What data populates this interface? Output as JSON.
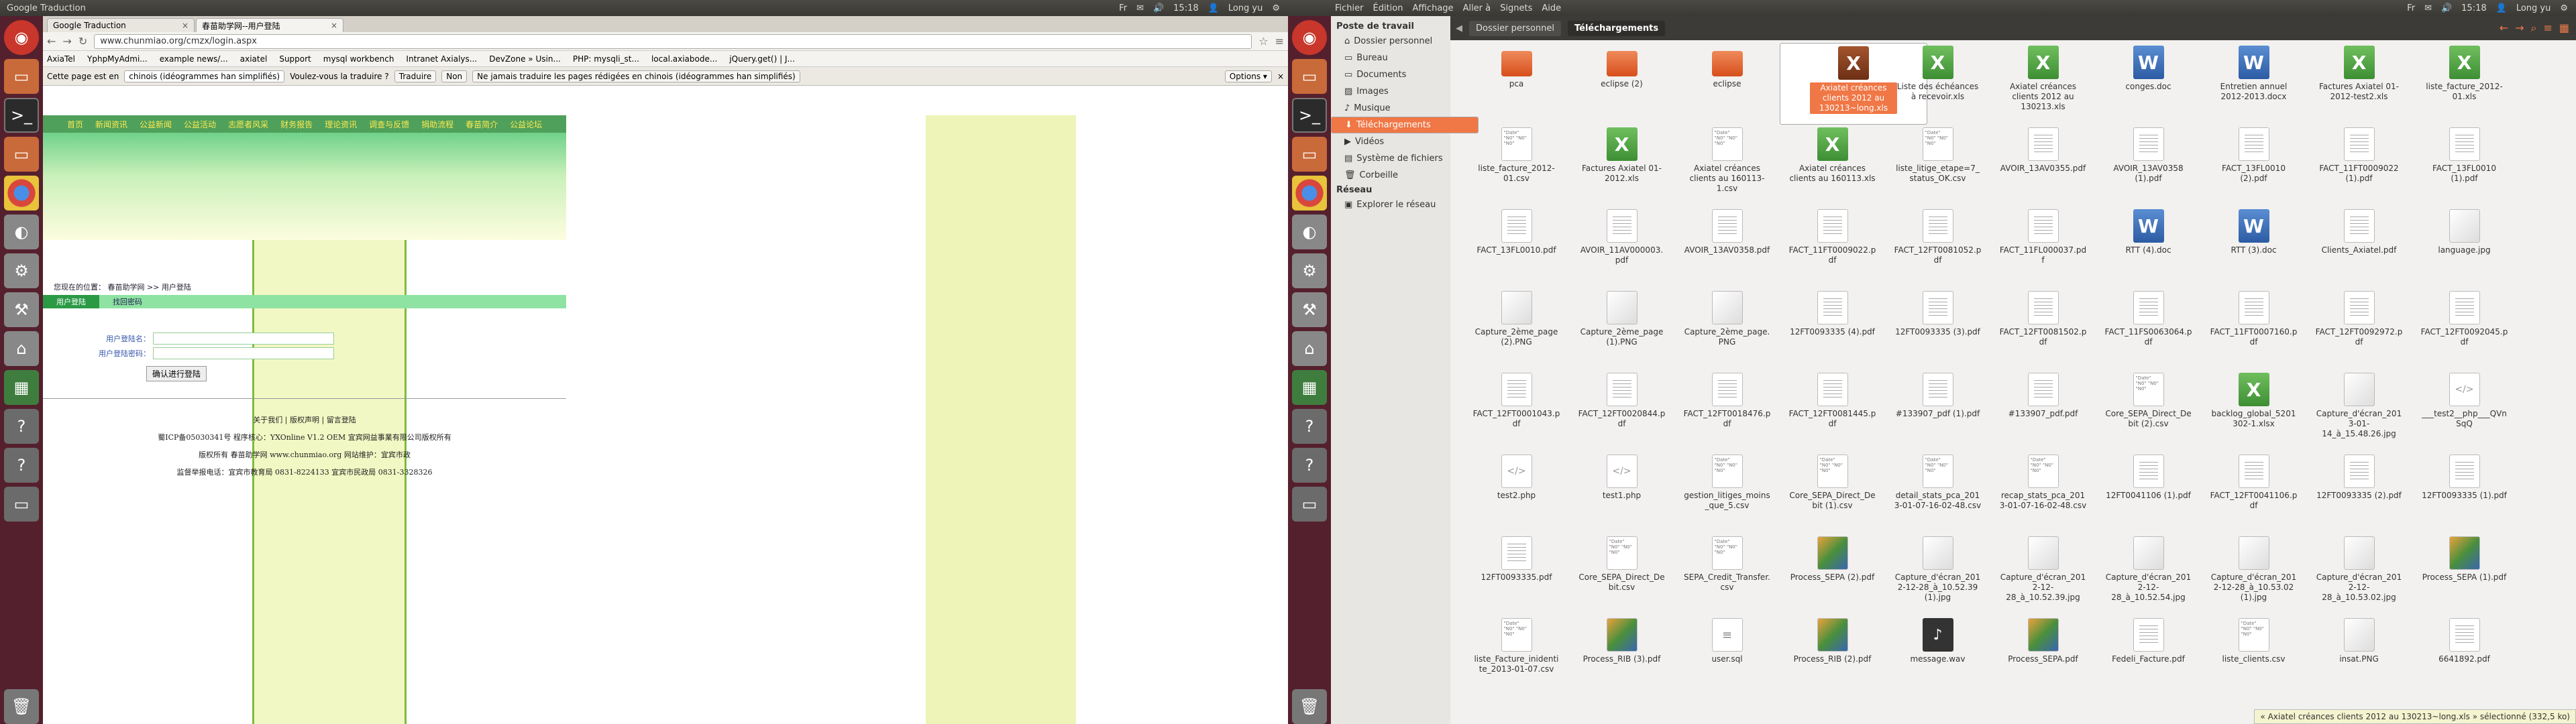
{
  "screen1": {
    "topbar": {
      "title": "Google Traduction",
      "right_items": [
        "Fr",
        "✉",
        "🔊",
        "15:18",
        "👤",
        "Long yu",
        "⚙"
      ]
    },
    "browser": {
      "tabs": [
        {
          "label": "Google Traduction"
        },
        {
          "label": "春苗助学网--用户登陆"
        }
      ],
      "url": "www.chunmiao.org/cmzx/login.aspx",
      "bookmarks": [
        "AxiaTel",
        "YphpMyAdmi...",
        "example news/...",
        "axiatel",
        "Support",
        "mysql workbench",
        "Intranet Axialys...",
        "DevZone » Usin...",
        "PHP: mysqli_st...",
        "local.axiabode...",
        "jQuery.get() | J..."
      ],
      "translate_bar": {
        "prompt": "Cette page est en",
        "language": "chinois (idéogrammes han simplifiés)",
        "question": "Voulez-vous la traduire ?",
        "translate": "Traduire",
        "no": "Non",
        "never": "Ne jamais traduire les pages rédigées en chinois (idéogrammes han simplifiés)",
        "options": "Options ▾"
      },
      "page": {
        "nav": [
          "首页",
          "新闻资讯",
          "公益新闻",
          "公益活动",
          "志愿者风采",
          "财务报告",
          "理论资讯",
          "调查与反馈",
          "捐助流程",
          "春苗简介",
          "公益论坛"
        ],
        "breadcrumb": "您现在的位置： 春苗助学网 >> 用户登陆",
        "tabs": [
          "用户登陆",
          "找回密码"
        ],
        "user_label": "用户登陆名：",
        "pass_label": "用户登陆密码：",
        "login_button": "确认进行登陆",
        "footer": [
          "关于我们 | 版权声明 | 留言登陆",
          "蜀ICP备05030341号 程序核心：YXOnline V1.2 OEM 宜宾网益事業有限公司版权所有",
          "版权所有 春苗助学网 www.chunmiao.org 网站维护：宜宾市政",
          "监督举报电话：宜宾市教育局 0831-8224133 宜宾市民政局 0831-3328326"
        ]
      }
    }
  },
  "screen2": {
    "topbar": {
      "menu": [
        "Fichier",
        "Édition",
        "Affichage",
        "Aller à",
        "Signets",
        "Aide"
      ],
      "right_items": [
        "Fr",
        "✉",
        "🔊",
        "15:18",
        "👤",
        "Long yu",
        "⚙"
      ]
    },
    "sidebar": {
      "header1": "Poste de travail",
      "items": [
        "Dossier personnel",
        "Bureau",
        "Documents",
        "Images",
        "Musique",
        "Téléchargements",
        "Vidéos",
        "Système de fichiers",
        "Corbeille"
      ],
      "header2": "Réseau",
      "items2": [
        "Explorer le réseau"
      ]
    },
    "breadcrumb": [
      "Dossier personnel",
      "Téléchargements"
    ],
    "files": [
      {
        "name": "pca",
        "type": "folder"
      },
      {
        "name": "eclipse (2)",
        "type": "folder"
      },
      {
        "name": "eclipse",
        "type": "folder"
      },
      {
        "name": "Axiatel créances clients 2012 au 130213~long.xls",
        "type": "xlsdark",
        "selected": true
      },
      {
        "name": "Liste des échéances à recevoir.xls",
        "type": "xls"
      },
      {
        "name": "Axiatel créances clients 2012 au 130213.xls",
        "type": "xls"
      },
      {
        "name": "conges.doc",
        "type": "doc"
      },
      {
        "name": "Entretien annuel 2012-2013.docx",
        "type": "doc"
      },
      {
        "name": "Factures Axiatel 01-2012-test2.xls",
        "type": "xls"
      },
      {
        "name": "liste_facture_2012-01.xls",
        "type": "xls"
      },
      {
        "name": "liste_facture_2012-01.csv",
        "type": "txt"
      },
      {
        "name": "Factures Axiatel 01-2012.xls",
        "type": "xls"
      },
      {
        "name": "Axiatel créances clients au 160113-1.csv",
        "type": "txt"
      },
      {
        "name": "Axiatel créances clients au 160113.xls",
        "type": "xls"
      },
      {
        "name": "liste_litige_etape=7_status_OK.csv",
        "type": "txt"
      },
      {
        "name": "AVOIR_13AV0355.pdf",
        "type": "pdf"
      },
      {
        "name": "AVOIR_13AV0358 (1).pdf",
        "type": "pdf"
      },
      {
        "name": "FACT_13FL0010 (2).pdf",
        "type": "pdf"
      },
      {
        "name": "FACT_11FT0009022 (1).pdf",
        "type": "pdf"
      },
      {
        "name": "FACT_13FL0010 (1).pdf",
        "type": "pdf"
      },
      {
        "name": "FACT_13FL0010.pdf",
        "type": "pdf"
      },
      {
        "name": "AVOIR_11AV000003.pdf",
        "type": "pdf"
      },
      {
        "name": "AVOIR_13AV0358.pdf",
        "type": "pdf"
      },
      {
        "name": "FACT_11FT0009022.pdf",
        "type": "pdf"
      },
      {
        "name": "FACT_12FT0081052.pdf",
        "type": "pdf"
      },
      {
        "name": "FACT_11FL000037.pdf",
        "type": "pdf"
      },
      {
        "name": "RTT (4).doc",
        "type": "doc"
      },
      {
        "name": "RTT (3).doc",
        "type": "doc"
      },
      {
        "name": "Clients_Axiatel.pdf",
        "type": "pdf"
      },
      {
        "name": "language.jpg",
        "type": "img"
      },
      {
        "name": "Capture_2ème_page (2).PNG",
        "type": "img"
      },
      {
        "name": "Capture_2ème_page (1).PNG",
        "type": "img"
      },
      {
        "name": "Capture_2ème_page.PNG",
        "type": "img"
      },
      {
        "name": "12FT0093335 (4).pdf",
        "type": "pdf"
      },
      {
        "name": "12FT0093335 (3).pdf",
        "type": "pdf"
      },
      {
        "name": "FACT_12FT0081502.pdf",
        "type": "pdf"
      },
      {
        "name": "FACT_11FS0063064.pdf",
        "type": "pdf"
      },
      {
        "name": "FACT_11FT0007160.pdf",
        "type": "pdf"
      },
      {
        "name": "FACT_12FT0092972.pdf",
        "type": "pdf"
      },
      {
        "name": "FACT_12FT0092045.pdf",
        "type": "pdf"
      },
      {
        "name": "FACT_12FT0001043.pdf",
        "type": "pdf"
      },
      {
        "name": "FACT_12FT0020844.pdf",
        "type": "pdf"
      },
      {
        "name": "FACT_12FT0018476.pdf",
        "type": "pdf"
      },
      {
        "name": "FACT_12FT0081445.pdf",
        "type": "pdf"
      },
      {
        "name": "#133907_pdf (1).pdf",
        "type": "pdf"
      },
      {
        "name": "#133907_pdf.pdf",
        "type": "pdf"
      },
      {
        "name": "Core_SEPA_Direct_Debit (2).csv",
        "type": "txt"
      },
      {
        "name": "backlog_global_5201302-1.xlsx",
        "type": "xls"
      },
      {
        "name": "Capture_d'écran_2013-01-14_à_15.48.26.jpg",
        "type": "img"
      },
      {
        "name": "___test2__php___QVnSqQ",
        "type": "code"
      },
      {
        "name": "test2.php",
        "type": "code"
      },
      {
        "name": "test1.php",
        "type": "code"
      },
      {
        "name": "gestion_litiges_moins_que_5.csv",
        "type": "txt"
      },
      {
        "name": "Core_SEPA_Direct_Debit (1).csv",
        "type": "txt"
      },
      {
        "name": "detail_stats_pca_2013-01-07-16-02-48.csv",
        "type": "txt"
      },
      {
        "name": "recap_stats_pca_2013-01-07-16-02-48.csv",
        "type": "txt"
      },
      {
        "name": "12FT0041106 (1).pdf",
        "type": "pdf"
      },
      {
        "name": "FACT_12FT0041106.pdf",
        "type": "pdf"
      },
      {
        "name": "12FT0093335 (2).pdf",
        "type": "pdf"
      },
      {
        "name": "12FT0093335 (1).pdf",
        "type": "pdf"
      },
      {
        "name": "12FT0093335.pdf",
        "type": "pdf"
      },
      {
        "name": "Core_SEPA_Direct_Debit.csv",
        "type": "txt"
      },
      {
        "name": "SEPA_Credit_Transfer.csv",
        "type": "txt"
      },
      {
        "name": "Process_SEPA (2).pdf",
        "type": "imgc"
      },
      {
        "name": "Capture_d'écran_2012-12-28_à_10.52.39 (1).jpg",
        "type": "img"
      },
      {
        "name": "Capture_d'écran_2012-12-28_à_10.52.39.jpg",
        "type": "img"
      },
      {
        "name": "Capture_d'écran_2012-12-28_à_10.52.54.jpg",
        "type": "img"
      },
      {
        "name": "Capture_d'écran_2012-12-28_à_10.53.02 (1).jpg",
        "type": "img"
      },
      {
        "name": "Capture_d'écran_2012-12-28_à_10.53.02.jpg",
        "type": "img"
      },
      {
        "name": "Process_SEPA (1).pdf",
        "type": "imgc"
      },
      {
        "name": "liste_Facture_inidentite_2013-01-07.csv",
        "type": "txt"
      },
      {
        "name": "Process_RIB (3).pdf",
        "type": "imgc"
      },
      {
        "name": "user.sql",
        "type": "sql"
      },
      {
        "name": "Process_RIB (2).pdf",
        "type": "imgc"
      },
      {
        "name": "message.wav",
        "type": "wav"
      },
      {
        "name": "Process_SEPA.pdf",
        "type": "imgc"
      },
      {
        "name": "Fedeli_Facture.pdf",
        "type": "pdf"
      },
      {
        "name": "liste_clients.csv",
        "type": "txt"
      },
      {
        "name": "insat.PNG",
        "type": "img"
      },
      {
        "name": "6641892.pdf",
        "type": "pdf"
      }
    ],
    "status": "« Axiatel créances clients 2012 au 130213~long.xls » sélectionné (332,5 ko)"
  }
}
